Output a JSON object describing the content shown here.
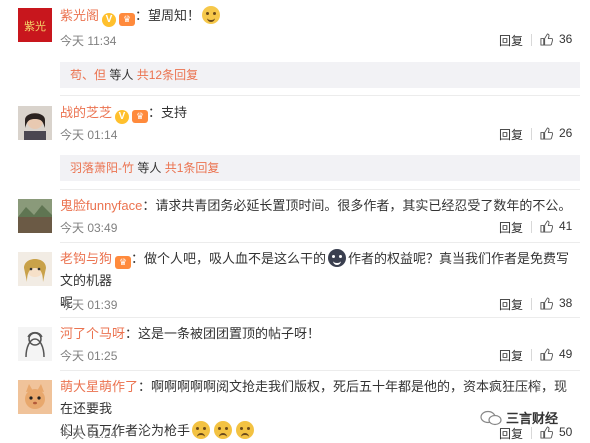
{
  "comments": [
    {
      "user": "紫光阁",
      "colon": "：",
      "text_before": "望周知！",
      "text_after": "",
      "time": "今天 11:34",
      "reply": "回复",
      "likes": "36",
      "badges": [
        "verified",
        "vip"
      ],
      "emoji_after": "smile",
      "subreplies": {
        "names": "苟、但",
        "suffix": "等人",
        "count_text": "共12条回复"
      }
    },
    {
      "user": "战的芝芝",
      "colon": "：",
      "text_before": "支持",
      "text_after": "",
      "time": "今天 01:14",
      "reply": "回复",
      "likes": "26",
      "badges": [
        "verified",
        "vip"
      ],
      "subreplies": {
        "names": "羽落萧阳-竹",
        "suffix": "等人",
        "count_text": "共1条回复"
      }
    },
    {
      "user": "鬼脸funnyface",
      "colon": "：",
      "text_before": "请求共青团务必延长置顶时间。很多作者，其实已经忍受了数年的不公。",
      "time": "今天 03:49",
      "reply": "回复",
      "likes": "41"
    },
    {
      "user": "老钩与狗",
      "colon": "：",
      "text_before": "做个人吧，吸人血不是这么干的",
      "text_after": "作者的权益呢？真当我们作者是免费写文的机器",
      "text_line2": "呢",
      "time": "今天 01:39",
      "reply": "回复",
      "likes": "38",
      "badges": [
        "vip"
      ]
    },
    {
      "user": "河了个马呀",
      "colon": "：",
      "text_before": "这是一条被团团置顶的帖子呀！",
      "time": "今天 01:25",
      "reply": "回复",
      "likes": "49"
    },
    {
      "user": "萌大星萌作了",
      "colon": "：",
      "text_before": "啊啊啊啊啊阅文抢走我们版权，死后五十年都是他的，资本疯狂压榨，现在还要我",
      "text_line2": "们八百万作者沦为枪手",
      "time": "今天 01:24",
      "reply": "回复",
      "likes": "50"
    }
  ],
  "watermark": "三言财经",
  "colors": {
    "username": "#eb7350",
    "subreply_bg": "#f2f2f5",
    "badge_v": "#ffc02d"
  }
}
